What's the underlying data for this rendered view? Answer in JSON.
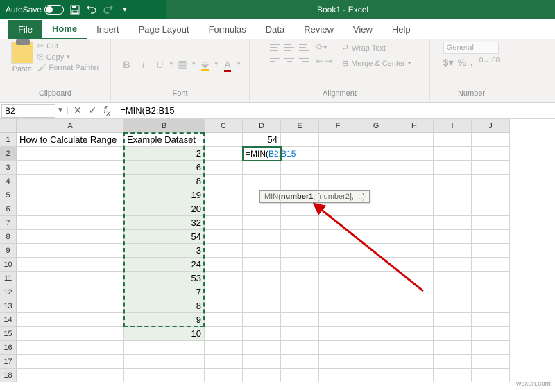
{
  "titlebar": {
    "autosave_label": "AutoSave",
    "title": "Book1 - Excel"
  },
  "menu": {
    "file": "File",
    "home": "Home",
    "insert": "Insert",
    "page_layout": "Page Layout",
    "formulas": "Formulas",
    "data": "Data",
    "review": "Review",
    "view": "View",
    "help": "Help"
  },
  "ribbon": {
    "clipboard": {
      "paste": "Paste",
      "cut": "Cut",
      "copy": "Copy",
      "format_painter": "Format Painter",
      "label": "Clipboard"
    },
    "font": {
      "bold": "B",
      "italic": "I",
      "underline": "U",
      "label": "Font"
    },
    "alignment": {
      "wrap": "Wrap Text",
      "merge": "Merge & Center",
      "label": "Alignment"
    },
    "number": {
      "format": "General",
      "label": "Number"
    }
  },
  "name_box": "B2",
  "formula_bar": "=MIN(B2:B15",
  "columns": [
    "A",
    "B",
    "C",
    "D",
    "E",
    "F",
    "G",
    "H",
    "I",
    "J"
  ],
  "headers": {
    "A1": "How to Calculate Range",
    "B1": "Example Dataset"
  },
  "data_b": [
    "2",
    "6",
    "8",
    "19",
    "20",
    "32",
    "54",
    "3",
    "24",
    "53",
    "7",
    "8",
    "9",
    "10"
  ],
  "d1_value": "54",
  "d2_formula_prefix": "=MIN(",
  "d2_formula_ref": "B2:B15",
  "tooltip": {
    "func": "MIN(",
    "bold": "number1",
    "rest": ", [number2], ...)"
  },
  "watermark": "wsxdn.com"
}
